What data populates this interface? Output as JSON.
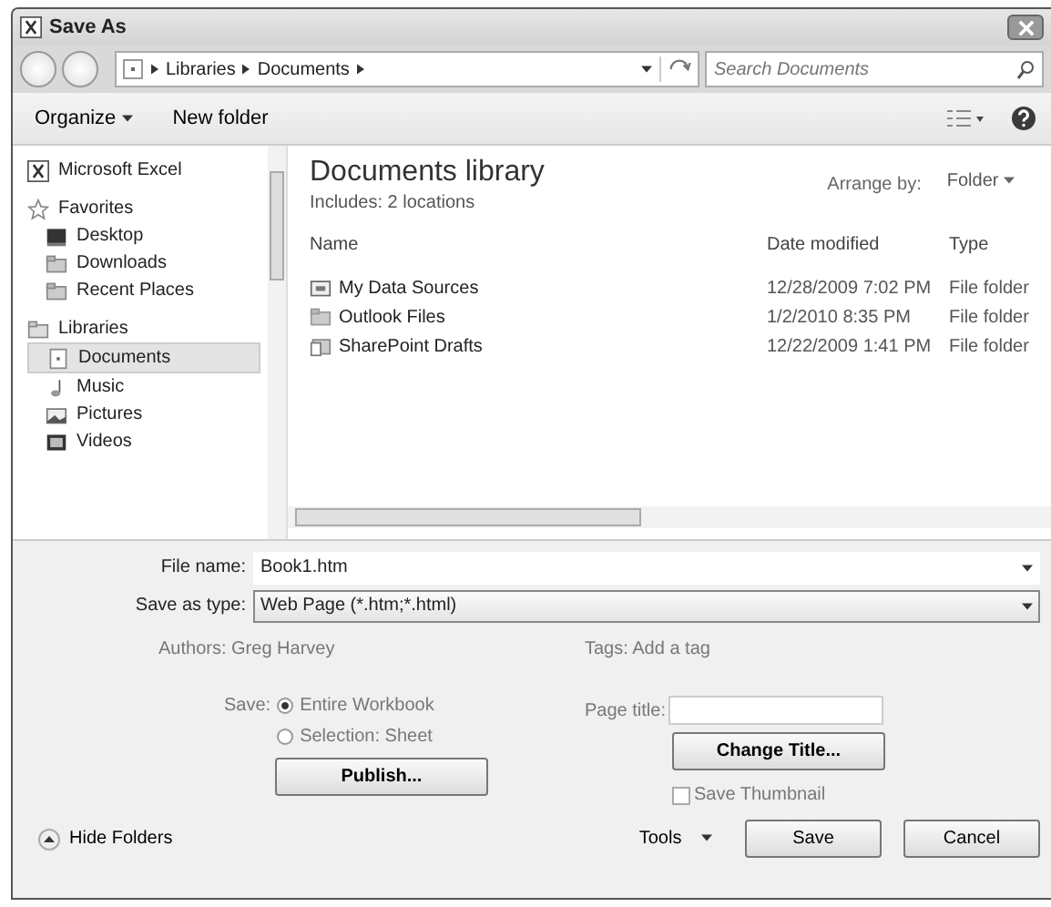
{
  "window": {
    "title": "Save As"
  },
  "address": {
    "path": [
      "Libraries",
      "Documents"
    ],
    "search_placeholder": "Search Documents"
  },
  "toolbar": {
    "organize": "Organize",
    "new_folder": "New folder"
  },
  "nav": [
    {
      "label": "Microsoft Excel",
      "kind": "excel",
      "selected": false
    },
    {
      "label": "Favorites",
      "kind": "star",
      "selected": false,
      "children": [
        {
          "label": "Desktop",
          "kind": "desktop",
          "selected": false
        },
        {
          "label": "Downloads",
          "kind": "folder",
          "selected": false
        },
        {
          "label": "Recent Places",
          "kind": "recent",
          "selected": false
        }
      ]
    },
    {
      "label": "Libraries",
      "kind": "library",
      "selected": false,
      "children": [
        {
          "label": "Documents",
          "kind": "doc",
          "selected": true
        },
        {
          "label": "Music",
          "kind": "music",
          "selected": false
        },
        {
          "label": "Pictures",
          "kind": "picture",
          "selected": false
        },
        {
          "label": "Videos",
          "kind": "video",
          "selected": false
        }
      ]
    }
  ],
  "library": {
    "title": "Documents library",
    "includes": "Includes:  2 locations",
    "arrange_label": "Arrange by:",
    "arrange_value": "Folder"
  },
  "columns": [
    "Name",
    "Date modified",
    "Type"
  ],
  "rows": [
    {
      "name": "My Data Sources",
      "date": "12/28/2009 7:02 PM",
      "type": "File folder",
      "kind": "data"
    },
    {
      "name": "Outlook Files",
      "date": "1/2/2010 8:35 PM",
      "type": "File folder",
      "kind": "folder"
    },
    {
      "name": "SharePoint Drafts",
      "date": "12/22/2009 1:41 PM",
      "type": "File folder",
      "kind": "sharepoint"
    }
  ],
  "form": {
    "file_name_label": "File name:",
    "file_name": "Book1.htm",
    "save_type_label": "Save as type:",
    "save_type": "Web Page (*.htm;*.html)",
    "authors": "Authors: Greg Harvey",
    "tags": "Tags: Add a tag",
    "save_label": "Save:",
    "radios": [
      {
        "label": "Entire Workbook",
        "selected": true
      },
      {
        "label": "Selection: Sheet",
        "selected": false
      }
    ],
    "publish": "Publish...",
    "page_title_label": "Page title:",
    "change_title": "Change Title...",
    "thumbnail": {
      "label": "Save Thumbnail",
      "checked": false
    }
  },
  "footer": {
    "hide_folders": "Hide Folders",
    "tools": "Tools",
    "save": "Save",
    "cancel": "Cancel"
  }
}
